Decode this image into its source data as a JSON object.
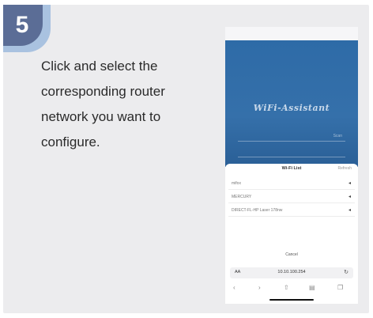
{
  "step": {
    "number": "5"
  },
  "instruction": {
    "lines": [
      "Click and select the",
      "corresponding router",
      "network you want to",
      "configure."
    ]
  },
  "phone": {
    "app_title": "WiFi-Assistant",
    "fields": [
      {
        "placeholder": "",
        "aux": "Scan"
      },
      {
        "placeholder": "",
        "aux": ""
      }
    ],
    "wifi_list": {
      "title": "Wi-Fi List",
      "refresh_label": "Refresh",
      "networks": [
        {
          "name": "mifox",
          "icon": "wifi-icon"
        },
        {
          "name": "MERCURY",
          "icon": "wifi-icon"
        },
        {
          "name": "DIRECT-FL-HP Laser 178nw",
          "icon": "wifi-icon"
        }
      ],
      "cancel_label": "Cancel"
    },
    "browser": {
      "aa_label": "AA",
      "url": "10.10.100.254",
      "reload_icon": "reload-icon"
    },
    "toolbar_icons": [
      "back-icon",
      "forward-icon",
      "share-icon",
      "bookmarks-icon",
      "tabs-icon"
    ]
  },
  "colors": {
    "badge": "#5b6d96",
    "badge_shadow": "#a9c2e0",
    "card_bg": "#ececee",
    "app_bg": "#2e6ba7"
  }
}
